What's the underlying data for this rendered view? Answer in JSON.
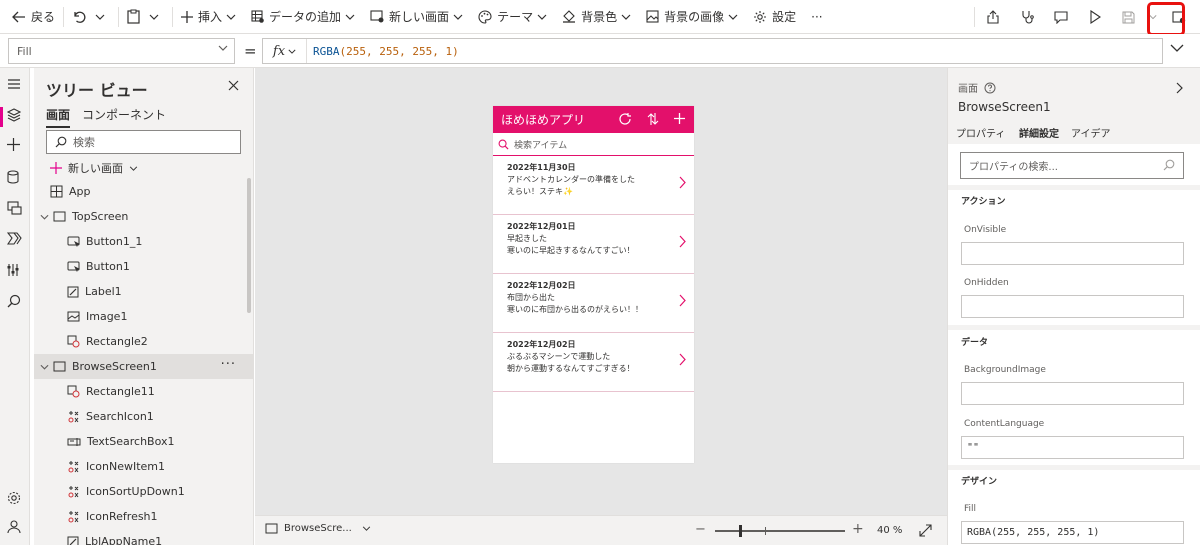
{
  "toolbar": {
    "back_label": "戻る",
    "insert_label": "挿入",
    "add_data_label": "データの追加",
    "new_screen_label": "新しい画面",
    "theme_label": "テーマ",
    "bg_color_label": "背景色",
    "bg_image_label": "背景の画像",
    "settings_label": "設定",
    "more_label": "···"
  },
  "formula": {
    "property": "Fill",
    "equals": "=",
    "fx_label": "fx",
    "fn": "RGBA",
    "args": "(255, 255, 255, 1)"
  },
  "tree": {
    "title": "ツリー ビュー",
    "tab_screens": "画面",
    "tab_components": "コンポーネント",
    "search_placeholder": "検索",
    "new_screen": "新しい画面",
    "items": [
      {
        "label": "App"
      },
      {
        "label": "TopScreen"
      },
      {
        "label": "Button1_1"
      },
      {
        "label": "Button1"
      },
      {
        "label": "Label1"
      },
      {
        "label": "Image1"
      },
      {
        "label": "Rectangle2"
      },
      {
        "label": "BrowseScreen1",
        "more": "···"
      },
      {
        "label": "Rectangle11"
      },
      {
        "label": "SearchIcon1"
      },
      {
        "label": "TextSearchBox1"
      },
      {
        "label": "IconNewItem1"
      },
      {
        "label": "IconSortUpDown1"
      },
      {
        "label": "IconRefresh1"
      },
      {
        "label": "LblAppName1"
      }
    ]
  },
  "app": {
    "title": "ほめほめアプリ",
    "search_placeholder": "検索アイテム",
    "items": [
      {
        "date": "2022年11月30日",
        "line1": "アドベントカレンダーの準備をした",
        "line2": "えらい！ステキ✨"
      },
      {
        "date": "2022年12月01日",
        "line1": "早起きした",
        "line2": "寒いのに早起きするなんてすごい！"
      },
      {
        "date": "2022年12月02日",
        "line1": "布団から出た",
        "line2": "寒いのに布団から出るのがえらい！！"
      },
      {
        "date": "2022年12月02日",
        "line1": "ぶるぶるマシーンで運動した",
        "line2": "朝から運動するなんてすごすぎる！"
      }
    ],
    "accent_color": "#e3106b"
  },
  "statusbar": {
    "screen": "BrowseScre...",
    "zoom_minus": "−",
    "zoom_plus": "+",
    "zoom": "40 %",
    "zoom_level_fraction": 0.4
  },
  "props": {
    "kind": "画面",
    "name": "BrowseScreen1",
    "tab_properties": "プロパティ",
    "tab_advanced": "詳細設定",
    "tab_ideas": "アイデア",
    "search_placeholder": "プロパティの検索...",
    "section_action": "アクション",
    "onvisible": "OnVisible",
    "onhidden": "OnHidden",
    "section_data": "データ",
    "bgimage": "BackgroundImage",
    "contentlang": "ContentLanguage",
    "contentlang_value": "\"\"",
    "section_design": "デザイン",
    "fill": "Fill",
    "fill_value": "RGBA(255, 255, 255, 1)"
  }
}
